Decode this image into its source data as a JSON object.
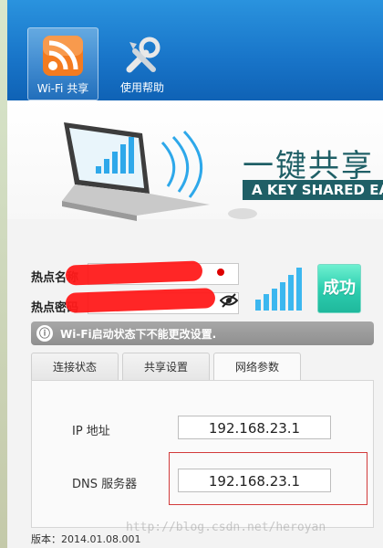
{
  "toolbar": {
    "items": [
      {
        "label": "Wi-Fi 共享",
        "icon": "rss-wifi-icon",
        "active": true
      },
      {
        "label": "使用帮助",
        "icon": "tools-icon",
        "active": false
      }
    ]
  },
  "banner": {
    "title": "一键共享 步",
    "subtitle": "A KEY SHARED EA"
  },
  "form": {
    "hotspot_name_label": "热点名称",
    "hotspot_password_label": "热点密码",
    "success_label": "成功"
  },
  "notice": {
    "icon": "info-icon",
    "text": "Wi-Fi启动状态下不能更改设置."
  },
  "tabs": [
    {
      "label": "连接状态"
    },
    {
      "label": "共享设置"
    },
    {
      "label": "网络参数"
    }
  ],
  "network": {
    "ip_label": "IP 地址",
    "ip_value": "192.168.23.1",
    "dns_label": "DNS 服务器",
    "dns_value": "192.168.23.1"
  },
  "version_text": "版本：2014.01.08.001",
  "watermark": "http://blog.csdn.net/heroyan",
  "colors": {
    "toolbar_blue": "#1874c8",
    "banner_teal": "#1f5f66",
    "success_green": "#2ecfb0",
    "highlight_red": "#d23b3b"
  }
}
